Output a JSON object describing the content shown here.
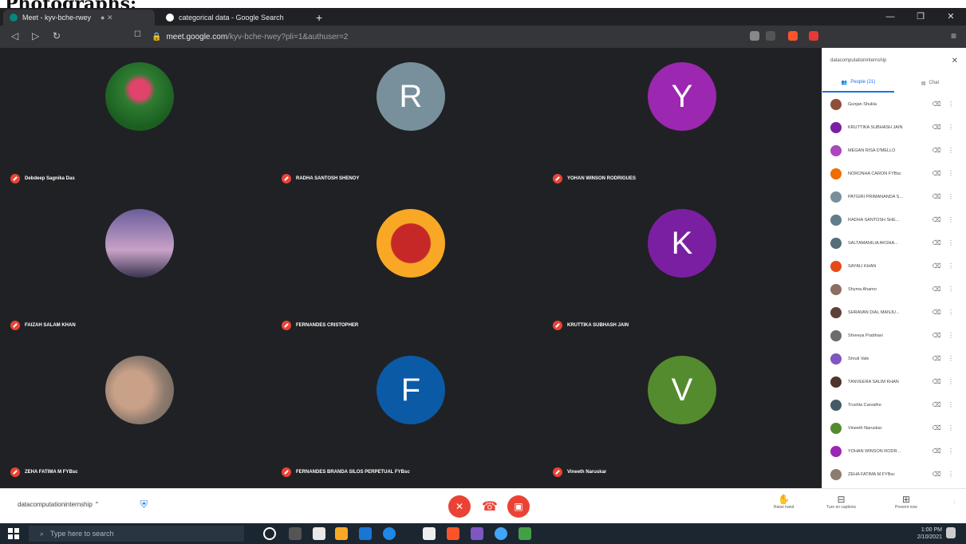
{
  "caption": "Photographs:",
  "browser": {
    "tabs": [
      {
        "title": "Meet - kyv-bche-rwey",
        "active": true
      },
      {
        "title": "categorical data - Google Search",
        "active": false
      }
    ],
    "new_tab_label": "+",
    "url_host": "meet.google.com",
    "url_path": "/kyv-bche-rwey?pli=1&authuser=2"
  },
  "tiles": [
    {
      "name": "Debdeep Sagnika Das",
      "letter": "",
      "color": "#2e7d32",
      "photo": "photo-icon"
    },
    {
      "name": "RADHA SANTOSH SHENOY",
      "letter": "R",
      "color": "#78909c"
    },
    {
      "name": "YOHAN WINSON RODRIGUES",
      "letter": "Y",
      "color": "#9c27b0"
    },
    {
      "name": "FAIZAH SALAM KHAN",
      "letter": "",
      "color": "#7b6fa8",
      "photo": "photo-icon"
    },
    {
      "name": "FERNANDES CRISTOPHER",
      "letter": "",
      "color": "#d84315",
      "photo": "among-us-icon"
    },
    {
      "name": "KRUTTIKA SUBHASH JAIN",
      "letter": "K",
      "color": "#7b1fa2"
    },
    {
      "name": "ZEHA FATIMA M FYBsc",
      "letter": "",
      "color": "#8d7b6e",
      "photo": "hand-photo-icon"
    },
    {
      "name": "FERNANDES BRANDA SILOS PERPETUAL FYBsc",
      "letter": "F",
      "color": "#0b5aa6"
    },
    {
      "name": "Vineeth Naruskar",
      "letter": "V",
      "color": "#558b2f"
    }
  ],
  "panel": {
    "title": "datacomputationinternship",
    "tab_people": "People (21)",
    "tab_chat": "Chat",
    "participants": [
      {
        "name": "Gunjan Shukla",
        "color": "#8d4e3a"
      },
      {
        "name": "KRUTTIKA SUBHASH JAIN",
        "color": "#7b1fa2"
      },
      {
        "name": "MEGAN RISA D'MELLO",
        "color": "#ab47bc"
      },
      {
        "name": "NORONHA CARON FYBsc",
        "color": "#ef6c00"
      },
      {
        "name": "PATGIRI PRIMANANDA S...",
        "color": "#78909c"
      },
      {
        "name": "RADHA SANTOSH SHE...",
        "color": "#607d8b"
      },
      {
        "name": "SALTAMANILIA AKSHA...",
        "color": "#546e7a"
      },
      {
        "name": "SAYALI KHAN",
        "color": "#e64a19"
      },
      {
        "name": "Shyma Ahamo",
        "color": "#8d6e63"
      },
      {
        "name": "SHRAVAN DIAL MANJU...",
        "color": "#5d4037"
      },
      {
        "name": "Shreeya Prabhavi",
        "color": "#6d6d6d"
      },
      {
        "name": "Shruti Vale",
        "color": "#7e57c2"
      },
      {
        "name": "TANVEERA SALIM KHAN",
        "color": "#4e342e"
      },
      {
        "name": "Trushla Carvalho",
        "color": "#455a64"
      },
      {
        "name": "Vineeth Naruskar",
        "color": "#558b2f"
      },
      {
        "name": "YOHAN WINSON RODR...",
        "color": "#9c27b0"
      },
      {
        "name": "ZEHA FATIMA M FYBsc",
        "color": "#8d7b6e"
      }
    ]
  },
  "controls": {
    "meeting_name": "datacomputationinternship",
    "raise_hand": "Raise hand",
    "captions": "Turn on captions",
    "present": "Present now"
  },
  "taskbar": {
    "search_placeholder": "Type here to search",
    "time": "1:00 PM",
    "date": "2/10/2021"
  }
}
